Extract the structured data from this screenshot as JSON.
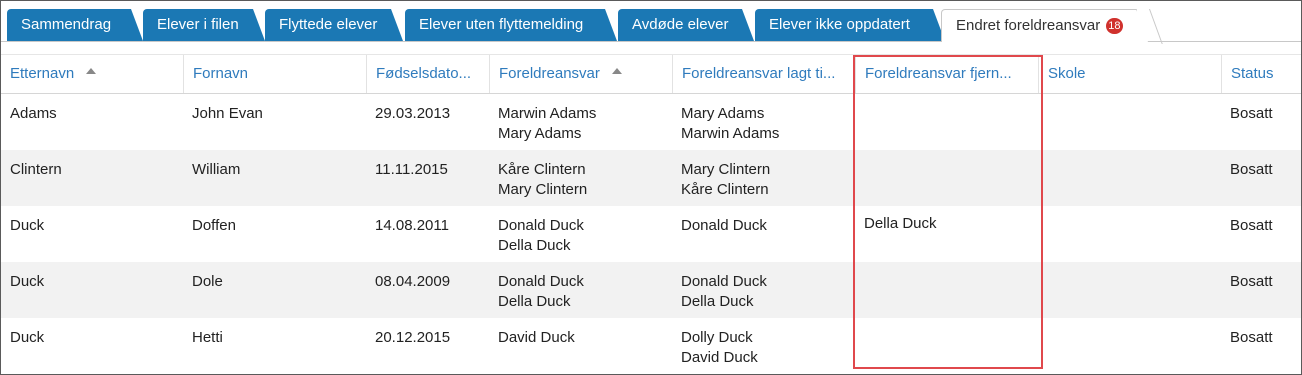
{
  "tabs": [
    {
      "label": "Sammendrag"
    },
    {
      "label": "Elever i filen"
    },
    {
      "label": "Flyttede elever"
    },
    {
      "label": "Elever uten flyttemelding"
    },
    {
      "label": "Avdøde elever"
    },
    {
      "label": "Elever ikke oppdatert"
    },
    {
      "label": "Endret foreldreansvar",
      "badge": "18",
      "active": true
    }
  ],
  "table": {
    "columns": [
      {
        "label": "Etternavn",
        "sorted": true
      },
      {
        "label": "Fornavn"
      },
      {
        "label": "Fødselsdato..."
      },
      {
        "label": "Foreldreansvar",
        "sorted": true
      },
      {
        "label": "Foreldreansvar lagt ti..."
      },
      {
        "label": "Foreldreansvar fjern..."
      },
      {
        "label": "Skole"
      },
      {
        "label": "Status"
      }
    ],
    "rows": [
      {
        "etternavn": "Adams",
        "fornavn": "John Evan",
        "fodselsdato": "29.03.2013",
        "foreldreansvar": [
          "Marwin Adams",
          "Mary Adams"
        ],
        "lagt_til": [
          "Mary Adams",
          "Marwin Adams"
        ],
        "fjernet": [],
        "skole": "",
        "status": "Bosatt"
      },
      {
        "etternavn": "Clintern",
        "fornavn": "William",
        "fodselsdato": "11.11.2015",
        "foreldreansvar": [
          "Kåre Clintern",
          "Mary Clintern"
        ],
        "lagt_til": [
          "Mary Clintern",
          "Kåre Clintern"
        ],
        "fjernet": [],
        "skole": "",
        "status": "Bosatt"
      },
      {
        "etternavn": "Duck",
        "fornavn": "Doffen",
        "fodselsdato": "14.08.2011",
        "foreldreansvar": [
          "Donald Duck",
          "Della Duck"
        ],
        "lagt_til": [
          "Donald Duck"
        ],
        "fjernet": [
          "Della Duck"
        ],
        "skole": "",
        "status": "Bosatt"
      },
      {
        "etternavn": "Duck",
        "fornavn": "Dole",
        "fodselsdato": "08.04.2009",
        "foreldreansvar": [
          "Donald Duck",
          "Della Duck"
        ],
        "lagt_til": [
          "Donald Duck",
          "Della Duck"
        ],
        "fjernet": [],
        "skole": "",
        "status": "Bosatt"
      },
      {
        "etternavn": "Duck",
        "fornavn": "Hetti",
        "fodselsdato": "20.12.2015",
        "foreldreansvar": [
          "David Duck"
        ],
        "lagt_til": [
          "Dolly Duck",
          "David Duck"
        ],
        "fjernet": [],
        "skole": "",
        "status": "Bosatt"
      }
    ]
  },
  "colors": {
    "tab_bg": "#1b78b4",
    "header_text": "#2f7bbd",
    "badge": "#d0312d",
    "highlight": "#e0484c"
  }
}
